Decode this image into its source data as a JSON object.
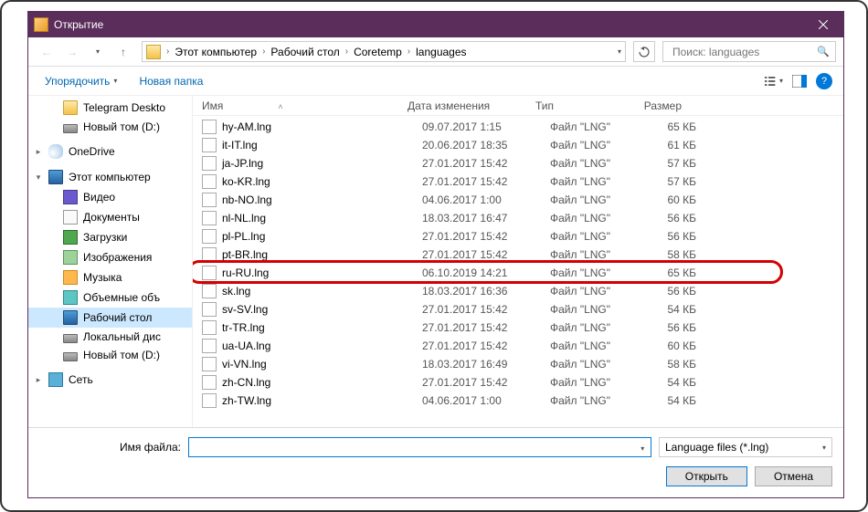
{
  "window": {
    "title": "Открытие"
  },
  "nav": {
    "crumbs": [
      "Этот компьютер",
      "Рабочий стол",
      "Coretemp",
      "languages"
    ],
    "search_placeholder": "Поиск: languages"
  },
  "toolbar": {
    "organize": "Упорядочить",
    "new_folder": "Новая папка"
  },
  "sidebar": {
    "items": [
      {
        "icon": "folder",
        "label": "Telegram Deskto",
        "lvl": 2
      },
      {
        "icon": "drive",
        "label": "Новый том (D:)",
        "lvl": 2
      },
      {
        "icon": "cloud",
        "label": "OneDrive",
        "lvl": 1,
        "expander": ">"
      },
      {
        "icon": "pc",
        "label": "Этот компьютер",
        "lvl": 1,
        "expander": "v"
      },
      {
        "icon": "vid",
        "label": "Видео",
        "lvl": 2
      },
      {
        "icon": "doc",
        "label": "Документы",
        "lvl": 2
      },
      {
        "icon": "dl",
        "label": "Загрузки",
        "lvl": 2
      },
      {
        "icon": "img",
        "label": "Изображения",
        "lvl": 2
      },
      {
        "icon": "mus",
        "label": "Музыка",
        "lvl": 2
      },
      {
        "icon": "3d",
        "label": "Объемные объ",
        "lvl": 2
      },
      {
        "icon": "pc",
        "label": "Рабочий стол",
        "lvl": 2,
        "selected": true
      },
      {
        "icon": "drive",
        "label": "Локальный дис",
        "lvl": 2
      },
      {
        "icon": "drive",
        "label": "Новый том (D:)",
        "lvl": 2
      },
      {
        "icon": "net",
        "label": "Сеть",
        "lvl": 1,
        "expander": ">"
      }
    ]
  },
  "columns": {
    "name": "Имя",
    "date": "Дата изменения",
    "type": "Тип",
    "size": "Размер"
  },
  "files": [
    {
      "name": "hy-AM.lng",
      "date": "09.07.2017 1:15",
      "type": "Файл \"LNG\"",
      "size": "65 КБ"
    },
    {
      "name": "it-IT.lng",
      "date": "20.06.2017 18:35",
      "type": "Файл \"LNG\"",
      "size": "61 КБ"
    },
    {
      "name": "ja-JP.lng",
      "date": "27.01.2017 15:42",
      "type": "Файл \"LNG\"",
      "size": "57 КБ"
    },
    {
      "name": "ko-KR.lng",
      "date": "27.01.2017 15:42",
      "type": "Файл \"LNG\"",
      "size": "57 КБ"
    },
    {
      "name": "nb-NO.lng",
      "date": "04.06.2017 1:00",
      "type": "Файл \"LNG\"",
      "size": "60 КБ"
    },
    {
      "name": "nl-NL.lng",
      "date": "18.03.2017 16:47",
      "type": "Файл \"LNG\"",
      "size": "56 КБ"
    },
    {
      "name": "pl-PL.lng",
      "date": "27.01.2017 15:42",
      "type": "Файл \"LNG\"",
      "size": "56 КБ"
    },
    {
      "name": "pt-BR.lng",
      "date": "27.01.2017 15:42",
      "type": "Файл \"LNG\"",
      "size": "58 КБ"
    },
    {
      "name": "ru-RU.lng",
      "date": "06.10.2019 14:21",
      "type": "Файл \"LNG\"",
      "size": "65 КБ",
      "highlight": true
    },
    {
      "name": "sk.lng",
      "date": "18.03.2017 16:36",
      "type": "Файл \"LNG\"",
      "size": "56 КБ"
    },
    {
      "name": "sv-SV.lng",
      "date": "27.01.2017 15:42",
      "type": "Файл \"LNG\"",
      "size": "54 КБ"
    },
    {
      "name": "tr-TR.lng",
      "date": "27.01.2017 15:42",
      "type": "Файл \"LNG\"",
      "size": "56 КБ"
    },
    {
      "name": "ua-UA.lng",
      "date": "27.01.2017 15:42",
      "type": "Файл \"LNG\"",
      "size": "60 КБ"
    },
    {
      "name": "vi-VN.lng",
      "date": "18.03.2017 16:49",
      "type": "Файл \"LNG\"",
      "size": "58 КБ"
    },
    {
      "name": "zh-CN.lng",
      "date": "27.01.2017 15:42",
      "type": "Файл \"LNG\"",
      "size": "54 КБ"
    },
    {
      "name": "zh-TW.lng",
      "date": "04.06.2017 1:00",
      "type": "Файл \"LNG\"",
      "size": "54 КБ"
    }
  ],
  "footer": {
    "filename_label": "Имя файла:",
    "filename_value": "",
    "filter": "Language files (*.lng)",
    "open": "Открыть",
    "cancel": "Отмена"
  }
}
